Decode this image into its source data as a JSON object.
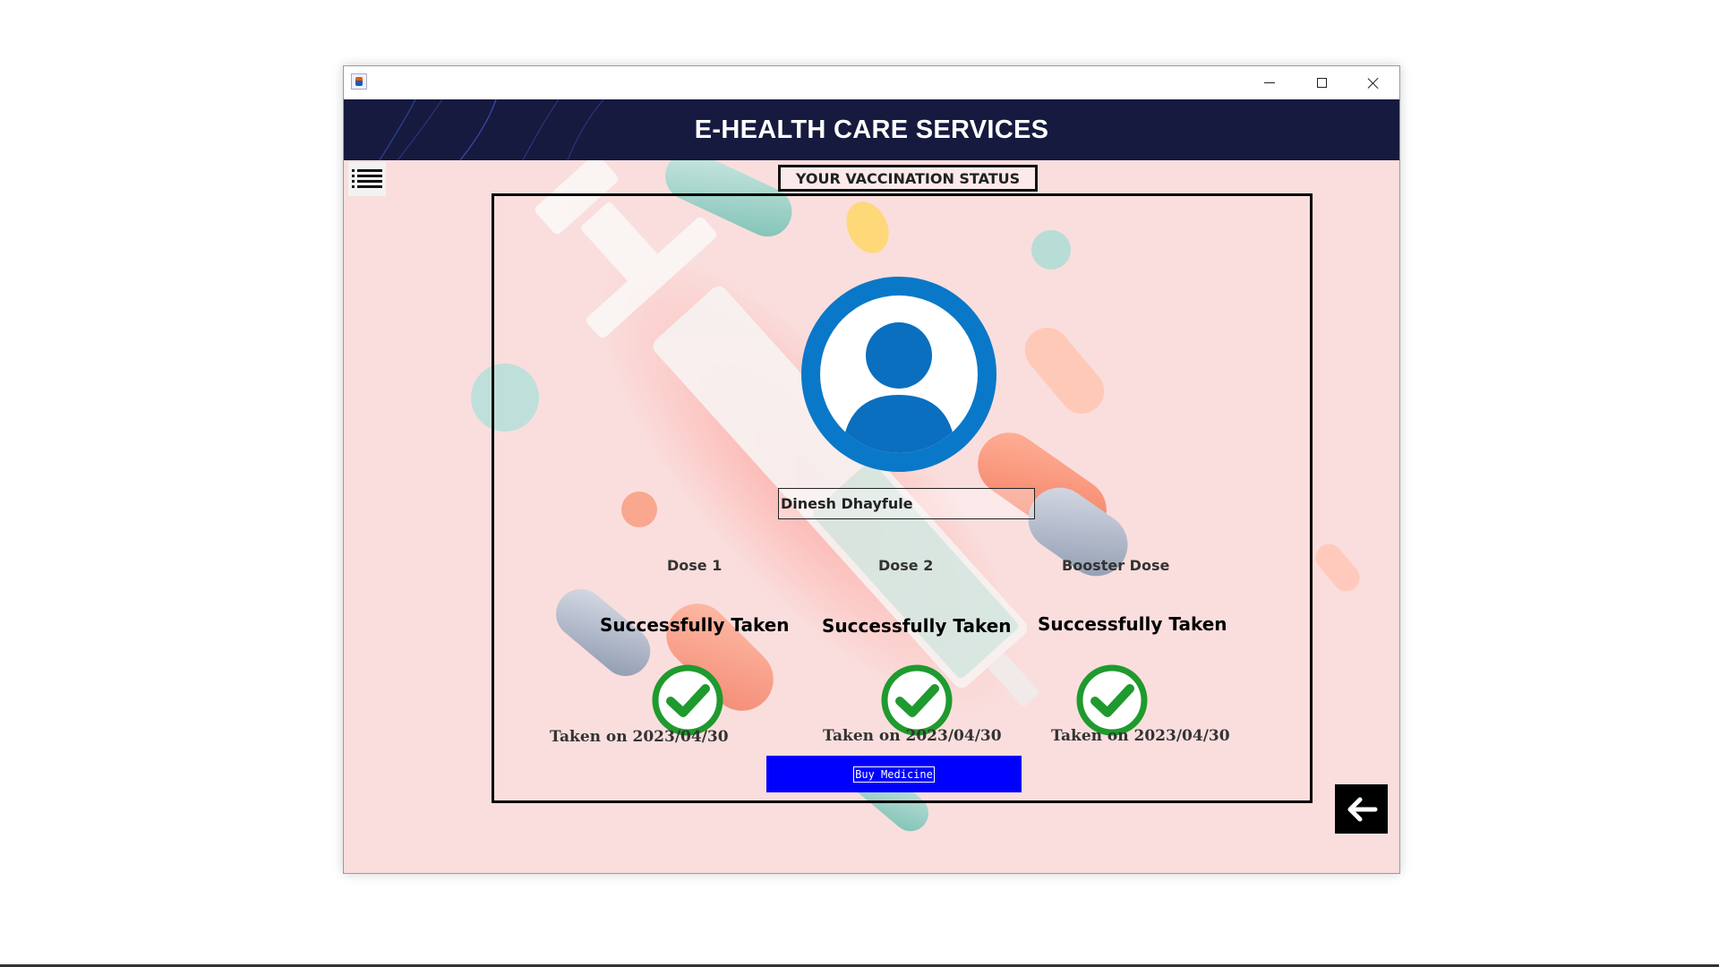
{
  "window": {
    "controls": {
      "minimize": "minimize",
      "maximize": "maximize",
      "close": "close"
    }
  },
  "header": {
    "title": "E-HEALTH CARE SERVICES"
  },
  "section": {
    "title": "YOUR VACCINATION STATUS"
  },
  "user": {
    "name": "Dinesh Dhayfule"
  },
  "doses": [
    {
      "label": "Dose 1",
      "status": "Successfully Taken",
      "date": "Taken on 2023/04/30"
    },
    {
      "label": "Dose 2",
      "status": "Successfully Taken",
      "date": "Taken on 2023/04/30"
    },
    {
      "label": "Booster Dose",
      "status": "Successfully Taken",
      "date": "Taken on 2023/04/30"
    }
  ],
  "actions": {
    "buy_medicine": "Buy Medicine"
  },
  "icons": {
    "menu": "list-icon",
    "avatar": "user-avatar-icon",
    "check": "check-circle-icon",
    "back": "arrow-left-icon",
    "app": "java-app-icon"
  },
  "colors": {
    "header_bg": "#161a3e",
    "content_bg": "#fadedd",
    "check_green": "#1f9a2e",
    "avatar_blue": "#0a78c8",
    "buy_bar": "#0000ff"
  }
}
